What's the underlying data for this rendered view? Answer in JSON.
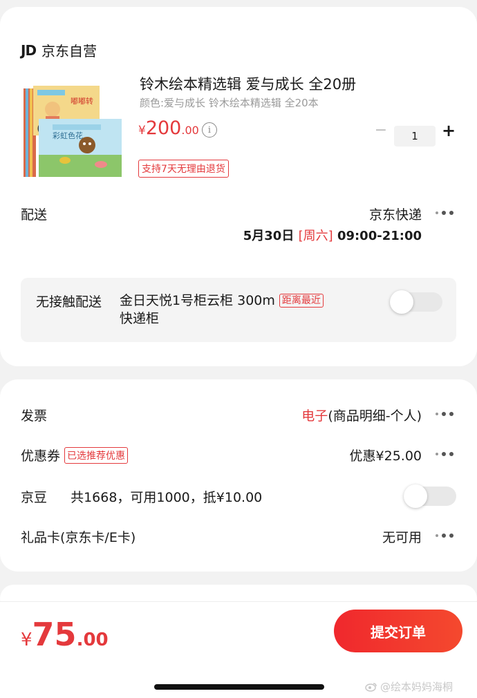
{
  "store": {
    "logo": "JD",
    "name": "京东自营"
  },
  "product": {
    "title": "铃木绘本精选辑  爱与成长 全20册",
    "variant": "颜色:爱与成长 铃木绘本精选辑 全20本",
    "price_currency": "¥",
    "price_int": "200",
    "price_dec": ".00",
    "info_icon": "info-icon",
    "quantity": "1",
    "minus": "−",
    "plus": "+",
    "return_policy": "支持7天无理由退货",
    "cover_text_1": "嘟嘟转",
    "cover_text_2": "彩虹色花"
  },
  "delivery": {
    "label": "配送",
    "carrier": "京东快递",
    "date": "5月30日",
    "weekday": "[周六]",
    "time": "09:00-21:00"
  },
  "contactless": {
    "label": "无接触配送",
    "address": "金日天悦1号柜云柜 300m",
    "tag": "距离最近",
    "address_line2": "快递柜",
    "enabled": false
  },
  "invoice": {
    "label": "发票",
    "type": "电子",
    "detail": "(商品明细-个人)"
  },
  "coupon": {
    "label": "优惠券",
    "tag": "已选推荐优惠",
    "value": "优惠¥25.00"
  },
  "jingdou": {
    "label": "京豆",
    "detail": "共1668，可用1000，抵¥10.00",
    "enabled": false
  },
  "giftcard": {
    "label": "礼品卡(京东卡/E卡)",
    "value": "无可用"
  },
  "footer": {
    "total_currency": "¥",
    "total_int": "75",
    "total_dec": ".00",
    "submit": "提交订单",
    "watermark": "@绘本妈妈海桐"
  },
  "colors": {
    "accent": "#e4393c",
    "background": "#f2f2f2",
    "card": "#ffffff"
  }
}
